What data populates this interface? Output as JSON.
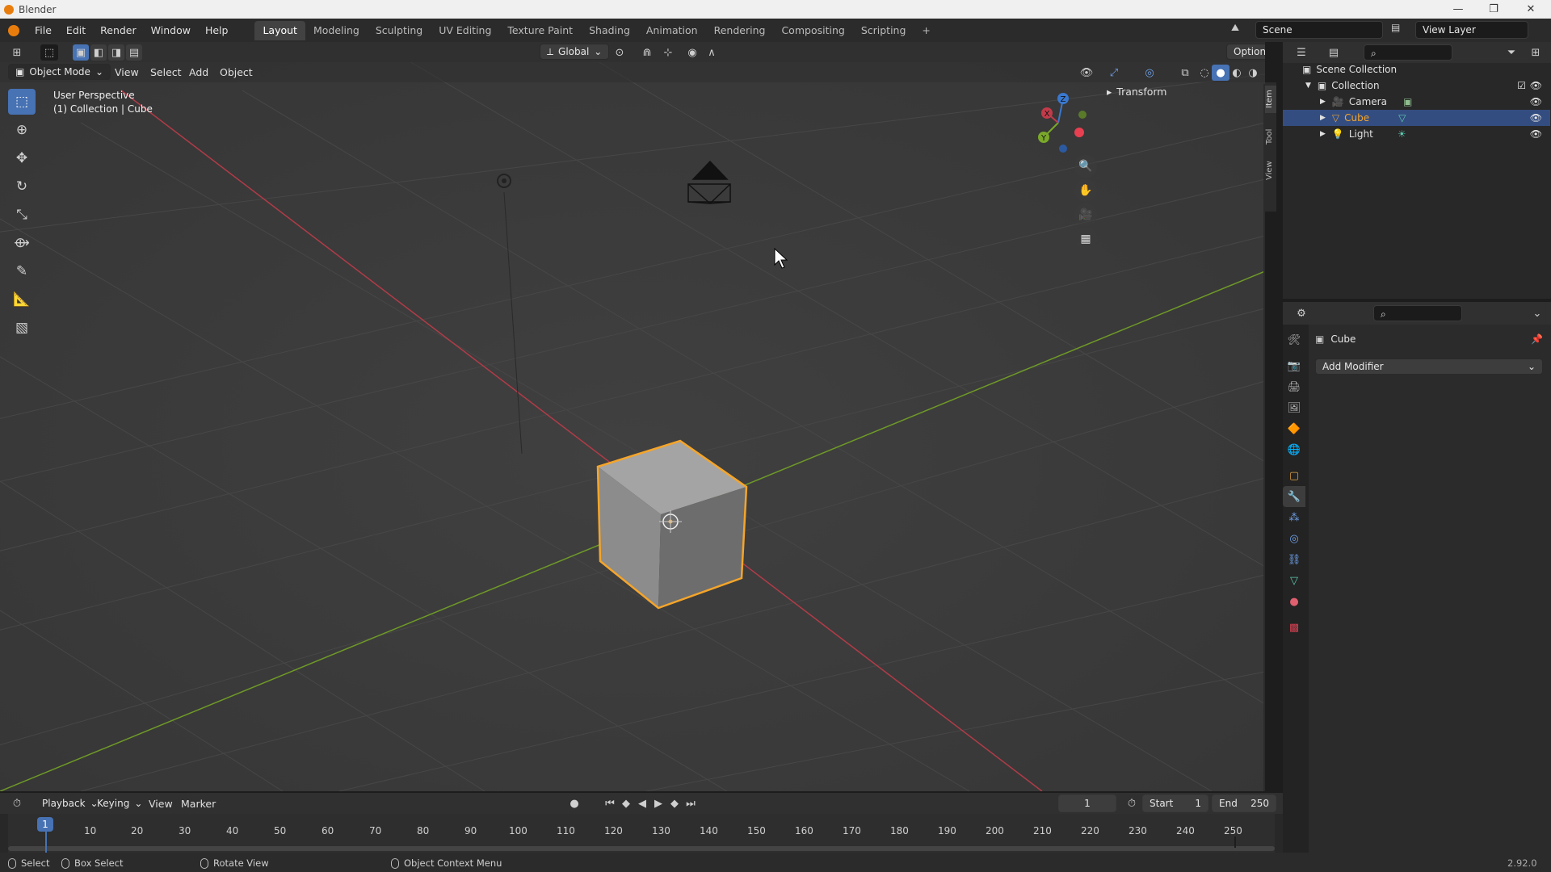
{
  "window": {
    "title": "Blender",
    "controls": [
      "—",
      "❐",
      "✕"
    ]
  },
  "menu": [
    "File",
    "Edit",
    "Render",
    "Window",
    "Help"
  ],
  "workspaces": [
    "Layout",
    "Modeling",
    "Sculpting",
    "UV Editing",
    "Texture Paint",
    "Shading",
    "Animation",
    "Rendering",
    "Compositing",
    "Scripting"
  ],
  "active_workspace": "Layout",
  "scene": {
    "name": "Scene",
    "view_layer": "View Layer"
  },
  "viewport_header": {
    "orientation": "Global",
    "options": "Options",
    "mode": "Object Mode",
    "menus": [
      "View",
      "Select",
      "Add",
      "Object"
    ]
  },
  "viewport": {
    "perspective": "User Perspective",
    "collection_info": "(1) Collection | Cube",
    "sidebar_panel": "Transform",
    "side_tabs": [
      "Item",
      "Tool",
      "View"
    ],
    "gizmo_axes": {
      "x": "X",
      "y": "Y",
      "z": "Z"
    }
  },
  "outliner": {
    "root": "Scene Collection",
    "collection": "Collection",
    "items": [
      {
        "name": "Camera",
        "selected": false,
        "icon_color": "#e0a040"
      },
      {
        "name": "Cube",
        "selected": true,
        "icon_color": "#e0a040"
      },
      {
        "name": "Light",
        "selected": false,
        "icon_color": "#e0a040"
      }
    ]
  },
  "properties": {
    "object_name": "Cube",
    "add_modifier": "Add Modifier"
  },
  "timeline": {
    "menus": [
      "Playback",
      "Keying",
      "View",
      "Marker"
    ],
    "current_frame": "1",
    "start_label": "Start",
    "start": "1",
    "end_label": "End",
    "end": "250",
    "ticks": [
      "1",
      "10",
      "20",
      "30",
      "40",
      "50",
      "60",
      "70",
      "80",
      "90",
      "100",
      "110",
      "120",
      "130",
      "140",
      "150",
      "160",
      "170",
      "180",
      "190",
      "200",
      "210",
      "220",
      "230",
      "240",
      "250"
    ]
  },
  "status_bar": {
    "select": "Select",
    "box_select": "Box Select",
    "rotate_view": "Rotate View",
    "context_menu": "Object Context Menu",
    "version": "2.92.0"
  },
  "colors": {
    "accent": "#4772b3",
    "selection_outline": "#f5a52a",
    "x_axis": "#c23b4a",
    "y_axis": "#7aa92a",
    "z_axis": "#3a78cf"
  }
}
